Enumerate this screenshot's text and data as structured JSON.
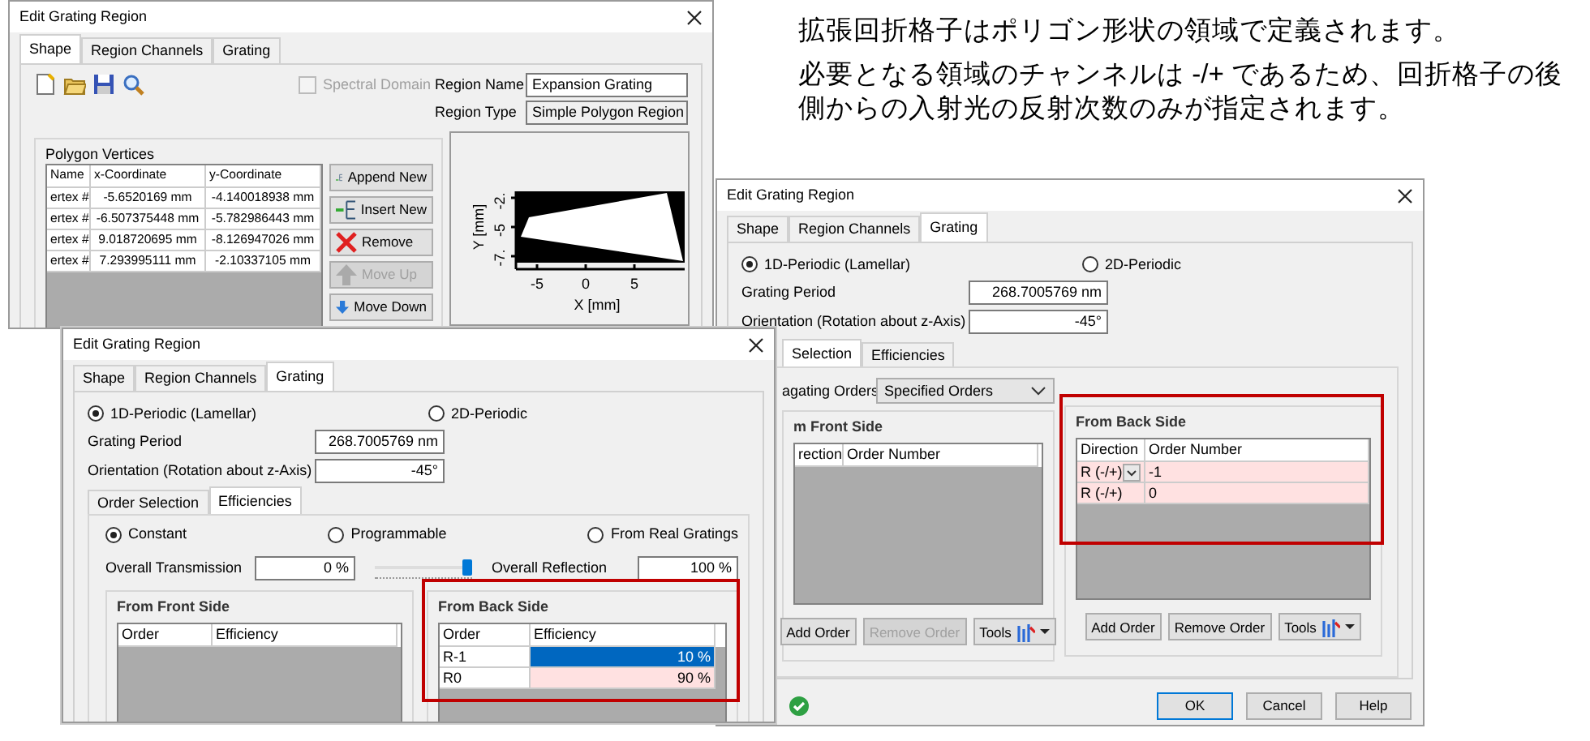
{
  "caption": {
    "paragraphs": [
      "拡張回折格子はポリゴン形状の領域で定義されます。",
      "必要となる領域のチャンネルは -/+ であるため、回折格子の後側からの入射光の反射次数のみが指定されます。"
    ]
  },
  "dialog_shape": {
    "title": "Edit Grating Region",
    "tabs": [
      {
        "label": "Shape",
        "selected": true
      },
      {
        "label": "Region Channels",
        "selected": false
      },
      {
        "label": "Grating",
        "selected": false
      }
    ],
    "spectral_domain": {
      "label": "Spectral Domain",
      "checked": false,
      "disabled": true
    },
    "region_name": {
      "label": "Region Name",
      "value": "Expansion Grating"
    },
    "region_type": {
      "label": "Region Type",
      "value": "Simple Polygon Region"
    },
    "vertices": {
      "title": "Polygon Vertices",
      "columns": [
        "Name",
        "x-Coordinate",
        "y-Coordinate"
      ],
      "rows": [
        [
          "ertex #",
          "-5.6520169 mm",
          "-4.140018938 mm"
        ],
        [
          "ertex #",
          "-6.507375448 mm",
          "-5.782986443 mm"
        ],
        [
          "ertex #",
          "9.018720695 mm",
          "-8.126947026 mm"
        ],
        [
          "ertex #",
          "7.293995111 mm",
          "-2.10337105 mm"
        ]
      ]
    },
    "buttons": [
      {
        "kind": "append",
        "label": "Append New",
        "disabled": false
      },
      {
        "kind": "insert",
        "label": "Insert New",
        "disabled": false
      },
      {
        "kind": "remove",
        "label": "Remove",
        "disabled": false
      },
      {
        "kind": "up",
        "label": "Move Up",
        "disabled": true
      },
      {
        "kind": "down",
        "label": "Move Down",
        "disabled": false
      }
    ],
    "plot": {
      "xlabel": "X [mm]",
      "ylabel": "Y [mm]",
      "xticks": [
        "-5",
        "0",
        "5"
      ],
      "yticks": [
        "-2.",
        "-5",
        "-7."
      ]
    }
  },
  "dialog_order_selection": {
    "title": "Edit Grating Region",
    "tabs": [
      {
        "label": "Shape",
        "selected": false
      },
      {
        "label": "Region Channels",
        "selected": false
      },
      {
        "label": "Grating",
        "selected": true
      }
    ],
    "periodicity": [
      {
        "label": "1D-Periodic (Lamellar)",
        "selected": true
      },
      {
        "label": "2D-Periodic",
        "selected": false
      }
    ],
    "grating_period": {
      "label": "Grating Period",
      "value": "268.7005769 nm"
    },
    "orientation": {
      "label": "Orientation (Rotation about z-Axis)",
      "value": "-45°"
    },
    "subtabs": [
      {
        "label": "Selection",
        "selected": true
      },
      {
        "label": "Efficiencies",
        "selected": false
      }
    ],
    "propagating_orders": {
      "label": "agating Orders",
      "value": "Specified Orders"
    },
    "front_side": {
      "title": "m Front Side",
      "highlighted": false,
      "columns": [
        "rection",
        "Order Number"
      ],
      "buttons": [
        {
          "kind": "text",
          "label": "Add Order",
          "disabled": false
        },
        {
          "kind": "text",
          "label": "Remove Order",
          "disabled": true
        },
        {
          "kind": "tools",
          "label": "Tools",
          "disabled": false
        }
      ]
    },
    "back_side": {
      "title": "From Back Side",
      "highlighted": true,
      "columns": [
        "Direction",
        "Order Number"
      ],
      "rows": [
        {
          "cells": [
            "R (-/+)",
            "-1"
          ],
          "editing": true
        },
        {
          "cells": [
            "R (-/+)",
            "0"
          ],
          "editing": false
        }
      ],
      "buttons": [
        {
          "kind": "text",
          "label": "Add Order",
          "disabled": false
        },
        {
          "kind": "text",
          "label": "Remove Order",
          "disabled": false
        },
        {
          "kind": "tools",
          "label": "Tools",
          "disabled": false
        }
      ]
    },
    "footer_buttons": [
      {
        "label": "OK",
        "default": true
      },
      {
        "label": "Cancel",
        "default": false
      },
      {
        "label": "Help",
        "default": false
      }
    ]
  },
  "dialog_efficiencies": {
    "title": "Edit Grating Region",
    "tabs": [
      {
        "label": "Shape",
        "selected": false
      },
      {
        "label": "Region Channels",
        "selected": false
      },
      {
        "label": "Grating",
        "selected": true
      }
    ],
    "periodicity": [
      {
        "label": "1D-Periodic (Lamellar)",
        "selected": true
      },
      {
        "label": "2D-Periodic",
        "selected": false
      }
    ],
    "grating_period": {
      "label": "Grating Period",
      "value": "268.7005769 nm"
    },
    "orientation": {
      "label": "Orientation (Rotation about z-Axis)",
      "value": "-45°"
    },
    "subtabs": [
      {
        "label": "Order Selection",
        "selected": false
      },
      {
        "label": "Efficiencies",
        "selected": true
      }
    ],
    "mode": [
      {
        "label": "Constant",
        "selected": true
      },
      {
        "label": "Programmable",
        "selected": false
      },
      {
        "label": "From Real Gratings",
        "selected": false
      }
    ],
    "transmission": {
      "label": "Overall Transmission",
      "value": "0 %"
    },
    "slider": {
      "level": 1.0
    },
    "reflection": {
      "label": "Overall Reflection",
      "value": "100 %"
    },
    "front_side": {
      "title": "From Front Side",
      "highlighted": false,
      "columns": [
        "Order",
        "Efficiency"
      ]
    },
    "back_side": {
      "title": "From Back Side",
      "highlighted": true,
      "columns": [
        "Order",
        "Efficiency"
      ],
      "rows": [
        {
          "cells": [
            "R-1",
            "10 %"
          ],
          "selected": true
        },
        {
          "cells": [
            "R0",
            "90 %"
          ],
          "selected": false
        }
      ]
    }
  }
}
